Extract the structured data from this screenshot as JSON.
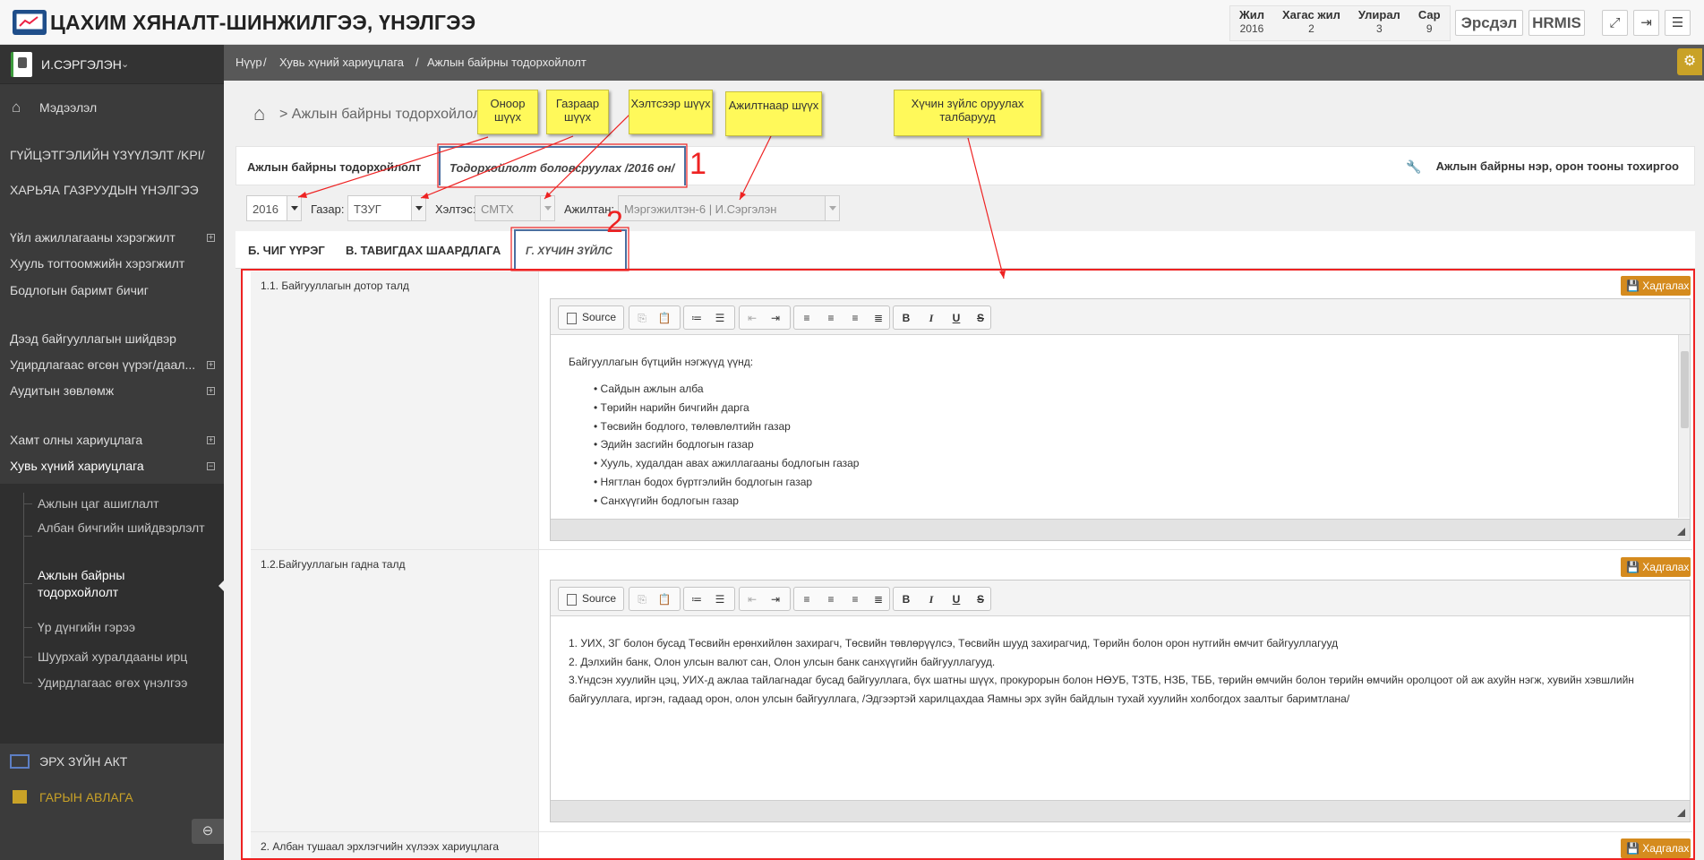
{
  "header": {
    "title": "ЦАХИМ ХЯНАЛТ-ШИНЖИЛГЭЭ, ҮНЭЛГЭЭ",
    "period_headers": [
      "Жил",
      "Хагас жил",
      "Улирал",
      "Сар"
    ],
    "period_values": [
      "2016",
      "2",
      "3",
      "9"
    ],
    "btn_ersdel": "Эрсдэл",
    "btn_hrmis": "HRMIS"
  },
  "sidebar": {
    "user": "И.СЭРГЭЛЭН",
    "items": [
      "Мэдээлэл",
      "ГҮЙЦЭТГЭЛИЙН ҮЗҮҮЛЭЛТ /KPI/",
      "ХАРЬЯА ГАЗРУУДЫН ҮНЭЛГЭЭ",
      "Үйл ажиллагааны хэрэгжилт",
      "Хууль тогтоомжийн хэрэгжилт",
      "Бодлогын баримт бичиг",
      "Дээд байгууллагын шийдвэр",
      "Удирдлагаас өгсөн үүрэг/даал...",
      "Аудитын зөвлөмж",
      "Хамт олны хариуцлага",
      "Хувь хүний хариуцлага"
    ],
    "sub_items": [
      "Ажлын цаг ашиглалт",
      "Албан бичгийн шийдвэрлэлт",
      "Ажлын байрны тодорхойлолт",
      "Үр дүнгийн гэрээ",
      "Шуурхай хуралдааны ирц",
      "Удирдлагаас өгөх үнэлгээ"
    ],
    "bottom_items": [
      "ЭРХ ЗҮЙН АКТ",
      "ГАРЫН АВЛАГА"
    ]
  },
  "breadcrumb": [
    "Нүүр",
    "Хувь хүний хариуцлага",
    "Ажлын байрны тодорхойлолт"
  ],
  "page": {
    "heading": "> Ажлын байрны тодорхойлолт",
    "tab_main": "Ажлын байрны тодорхойлолт",
    "tab_prepare": "Тодорхойлолт боловсруулах /2016 он/",
    "settings_link": "Ажлын байрны нэр, орон тооны тохиргоо"
  },
  "filters": {
    "year": "2016",
    "gazar_label": "Газар:",
    "gazar_value": "ТЗУГ",
    "heltes_label": "Хэлтэс:",
    "heltes_value": "СМТХ",
    "ajiltan_label": "Ажилтан:",
    "ajiltan_value": "Мэргэжилтэн-6 | И.Сэргэлэн"
  },
  "tabs2": [
    "Б. ЧИГ ҮҮРЭГ",
    "В. ТАВИГДАХ ШААРДЛАГА",
    "Г. ХҮЧИН ЗҮЙЛС"
  ],
  "rows": [
    {
      "label": "1.1. Байгууллагын дотор талд",
      "save": "Хадгалах",
      "intro": "Байгууллагын бүтцийн нэгжүүд үүнд:",
      "bullets": [
        "Сайдын ажлын алба",
        "Төрийн нарийн бичгийн дарга",
        "Төсвийн бодлого, төлөвлөлтийн газар",
        "Эдийн засгийн бодлогын газар",
        "Хууль, худалдан авах ажиллагааны бодлогын газар",
        "Нягтлан бодох бүртгэлийн бодлогын газар",
        "Санхүүгийн бодлогын газар"
      ]
    },
    {
      "label": "1.2.Байгууллагын гадна талд",
      "save": "Хадгалах",
      "lines": [
        "1. УИХ, ЗГ болон бусад Төсвийн ерөнхийлөн захирагч, Төсвийн төвлөрүүлсэ, Төсвийн шууд захирагчид, Төрийн болон орон нутгийн өмчит байгууллагууд",
        "2. Дэлхийн банк, Олон улсын валют сан, Олон улсын банк санхүүгийн байгууллагууд.",
        "3.Үндсэн хуулийн цэц, УИХ-д ажлаа тайлагнадаг бусад байгууллага, бүх шатны шүүх, прокурорын болон НӨУБ, ТЗТБ, НЗБ, ТББ, төрийн өмчийн болон төрийн өмчийн оролцоот ой аж ахуйн нэгж, хувийн хэвшлийн байгууллага, иргэн, гадаад орон, олон улсын байгууллага, /Эдгээртэй харилцахдаа Яамны эрх зүйн байдлын тухай хуулийн холбогдох заалтыг баримтлана/"
      ]
    },
    {
      "label": "2. Албан тушаал эрхлэгчийн хүлээх хариуцлага",
      "save": "Хадгалах"
    }
  ],
  "editor": {
    "source_label": "Source"
  },
  "callouts": {
    "c1": "Оноор шүүх",
    "c2": "Газраар шүүх",
    "c3": "Хэлтсээр шүүх",
    "c4": "Ажилтнаар шүүх",
    "c5": "Хүчин зүйлс оруулах талбарууд"
  },
  "markers": [
    "1",
    "2"
  ],
  "colors": {
    "accent": "#d58b1e",
    "annotation": "#e22222",
    "callout": "#fff95a"
  }
}
